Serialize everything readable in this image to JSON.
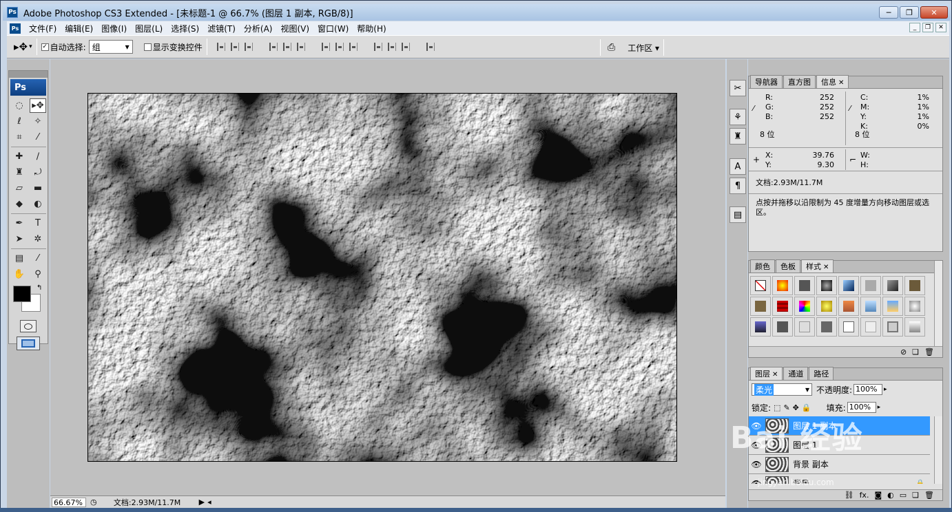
{
  "window": {
    "title": "Adobe Photoshop CS3 Extended - [未标题-1 @ 66.7% (图层 1 副本, RGB/8)]",
    "app_badge": "Ps",
    "minimize": "─",
    "restore": "❐",
    "close": "✕"
  },
  "menu": {
    "items": [
      "文件(F)",
      "编辑(E)",
      "图像(I)",
      "图层(L)",
      "选择(S)",
      "滤镜(T)",
      "分析(A)",
      "视图(V)",
      "窗口(W)",
      "帮助(H)"
    ]
  },
  "options": {
    "auto_select_label": "自动选择:",
    "auto_select_value": "组",
    "show_transform_label": "显示变换控件",
    "workspace_label": "工作区"
  },
  "toolbox": {
    "logo": "Ps"
  },
  "status": {
    "zoom": "66.67%",
    "doc_info": "文档:2.93M/11.7M"
  },
  "info_panel": {
    "tabs": [
      "导航器",
      "直方图",
      "信息"
    ],
    "r_label": "R:",
    "r": "252",
    "g_label": "G:",
    "g": "252",
    "b_label": "B:",
    "b": "252",
    "c_label": "C:",
    "c": "1%",
    "m_label": "M:",
    "m": "1%",
    "y_label": "Y:",
    "y": "1%",
    "k_label": "K:",
    "k": "0%",
    "bits_left": "8 位",
    "bits_right": "8 位",
    "x_label": "X:",
    "x": "39.76",
    "y_coord_label": "Y:",
    "y_coord": "9.30",
    "w_label": "W:",
    "h_label": "H:",
    "doc": "文档:2.93M/11.7M",
    "hint": "点按并拖移以沿限制为 45 度增量方向移动图层或选区。"
  },
  "styles_panel": {
    "tabs": [
      "颜色",
      "色板",
      "样式"
    ]
  },
  "layers_panel": {
    "tabs": [
      "图层",
      "通道",
      "路径"
    ],
    "blend_mode": "柔光",
    "opacity_label": "不透明度:",
    "opacity": "100%",
    "lock_label": "锁定:",
    "fill_label": "填充:",
    "fill": "100%",
    "layers": [
      {
        "name": "图层 1 副本",
        "selected": true
      },
      {
        "name": "图层 1",
        "selected": false
      },
      {
        "name": "背景 副本",
        "selected": false
      },
      {
        "name": "背景",
        "selected": false
      }
    ],
    "footer_fx": "fx."
  },
  "watermark": {
    "text": "Bai 经验",
    "sub": "jingyan.baidu.com"
  },
  "colors": {
    "selection": "#3399ff",
    "titlebar": "#b9cfe8"
  }
}
